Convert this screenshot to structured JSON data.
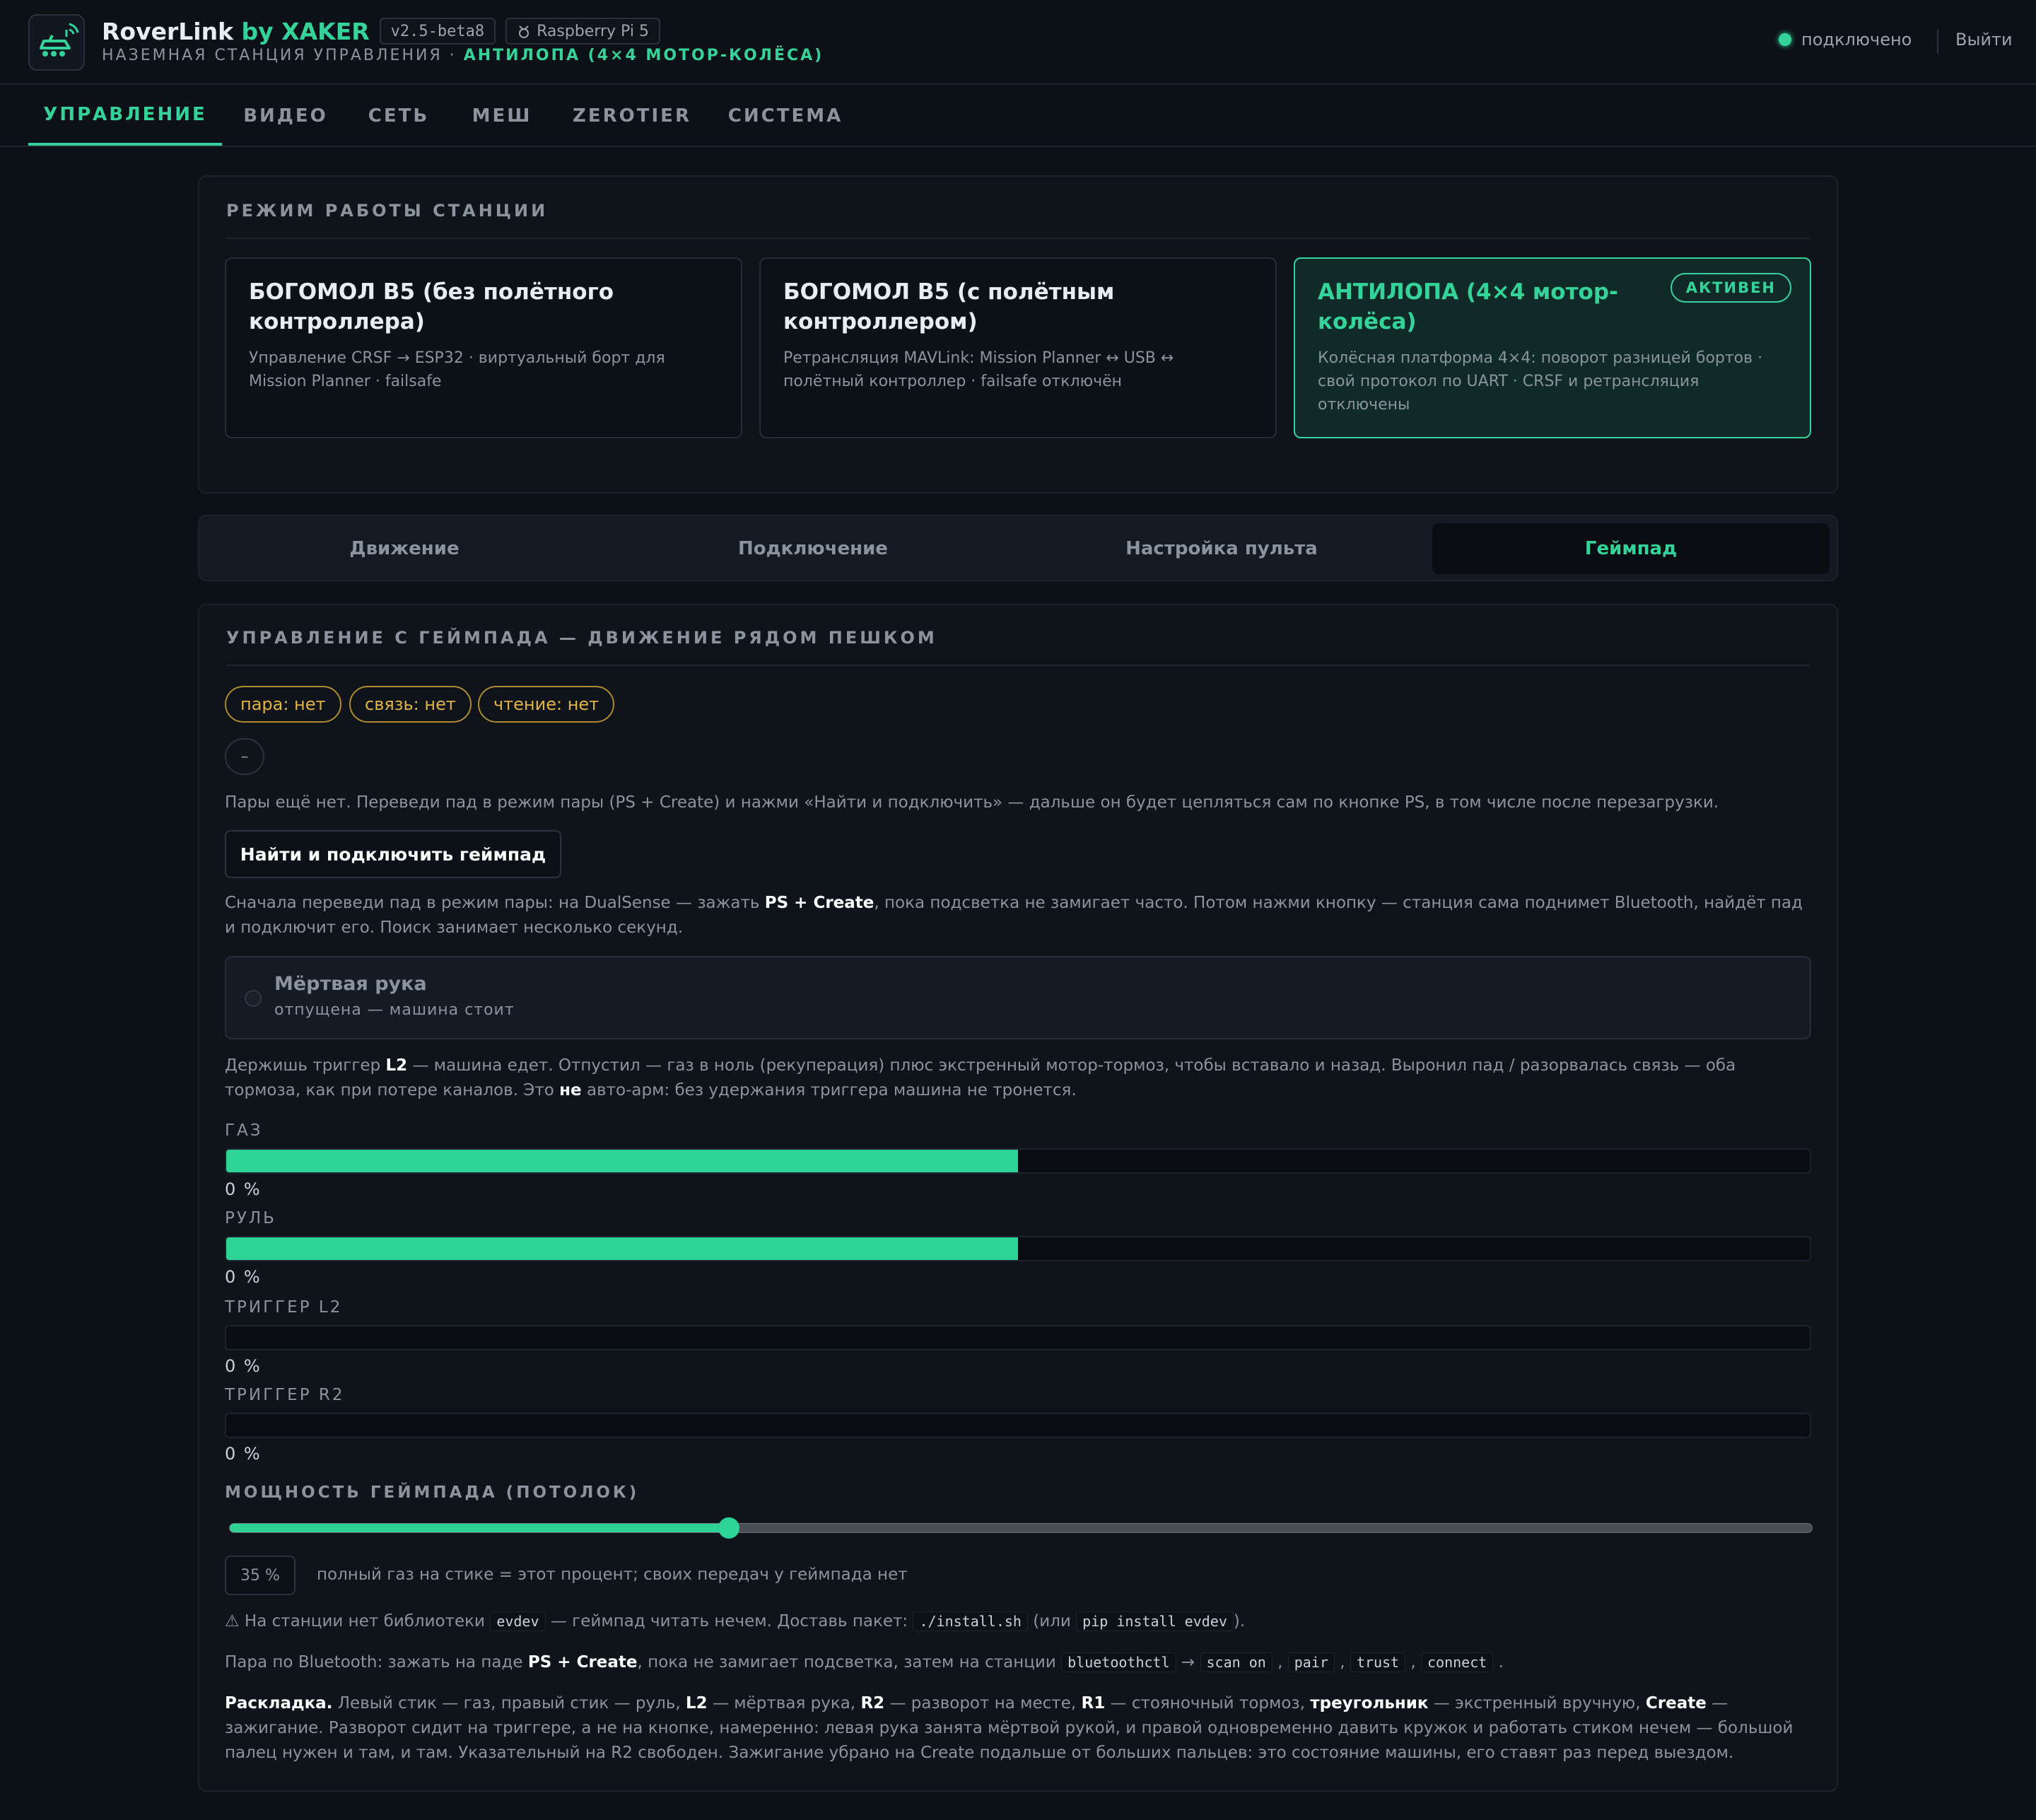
{
  "header": {
    "app_name": "RoverLink",
    "app_by": "by XAKER",
    "version": "v2.5-beta8",
    "platform": "Raspberry Pi 5",
    "subtitle_prefix": "НАЗЕМНАЯ СТАНЦИЯ УПРАВЛЕНИЯ ·",
    "subtitle_mode": "АНТИЛОПА (4×4 МОТОР-КОЛЁСА)",
    "status": "подключено",
    "logout": "Выйти"
  },
  "nav": [
    "УПРАВЛЕНИЕ",
    "ВИДЕО",
    "СЕТЬ",
    "МЕШ",
    "ZEROTIER",
    "СИСТЕМА"
  ],
  "modes": {
    "title": "РЕЖИМ РАБОТЫ СТАНЦИИ",
    "badge": "АКТИВЕН",
    "cards": [
      {
        "title": "БОГОМОЛ B5 (без полётного контроллера)",
        "desc": "Управление CRSF → ESP32 · виртуальный борт для Mission Planner · failsafe"
      },
      {
        "title": "БОГОМОЛ B5 (с полётным контроллером)",
        "desc": "Ретрансляция MAVLink: Mission Planner ↔ USB ↔ полётный контроллер · failsafe отключён"
      },
      {
        "title": "АНТИЛОПА (4×4 мотор-колёса)",
        "desc": "Колёсная платформа 4×4: поворот разницей бортов · свой протокол по UART · CRSF и ретрансляция отключены"
      }
    ]
  },
  "subtabs": [
    "Движение",
    "Подключение",
    "Настройка пульта",
    "Геймпад"
  ],
  "gamepad": {
    "title": "УПРАВЛЕНИЕ С ГЕЙМПАДА — ДВИЖЕНИЕ РЯДОМ ПЕШКОМ",
    "chips": [
      "пара: нет",
      "связь: нет",
      "чтение: нет"
    ],
    "dash": "–",
    "no_pair_text": "Пары ещё нет. Переведи пад в режим пары (PS + Create) и нажми «Найти и подключить» — дальше он будет цепляться сам по кнопке PS, в том числе после перезагрузки.",
    "connect_button": "Найти и подключить геймпад",
    "hint": {
      "a": "Сначала переведи пад в режим пары: на DualSense — зажать ",
      "b": "PS + Create",
      "c": ", пока подсветка не замигает часто. Потом нажми кнопку — станция сама поднимет Bluetooth, найдёт пад и подключит его. Поиск занимает несколько секунд."
    },
    "deadman_title": "Мёртвая рука",
    "deadman_sub": "отпущена — машина стоит",
    "deadman_text": {
      "a": "Держишь триггер ",
      "b": "L2",
      "c": " — машина едет. Отпустил — газ в ноль (рекуперация) плюс экстренный мотор-тормоз, чтобы вставало и назад. Выронил пад / разорвалась связь — оба тормоза, как при потере каналов. Это ",
      "d": "не",
      "e": " авто-арм: без удержания триггера машина не тронется."
    },
    "gauges": [
      {
        "label": "ГАЗ",
        "value": "0 %",
        "fill": 0.5
      },
      {
        "label": "РУЛЬ",
        "value": "0 %",
        "fill": 0.5
      },
      {
        "label": "ТРИГГЕР L2",
        "value": "0 %",
        "fill": 0
      },
      {
        "label": "ТРИГГЕР R2",
        "value": "0 %",
        "fill": 0
      }
    ],
    "power_title": "МОЩНОСТЬ ГЕЙМПАДА (ПОТОЛОК)",
    "power_value": 35,
    "power_display": "35 %",
    "power_note": "полный газ на стике = этот процент; своих передач у геймпада нет",
    "warn": {
      "a": "⚠ На станции нет библиотеки ",
      "code1": "evdev",
      "b": " — геймпад читать нечем. Доставь пакет: ",
      "code2": "./install.sh",
      "c": " (или ",
      "code3": "pip install evdev",
      "d": ")."
    },
    "bt": {
      "a": "Пара по Bluetooth: зажать на паде ",
      "b": "PS + Create",
      "c": ", пока не замигает подсветка, затем на станции ",
      "code1": "bluetoothctl",
      "arrow": " → ",
      "code2": "scan on",
      "code3": "pair",
      "code4": "trust",
      "code5": "connect",
      "sep": " , ",
      "end": " ."
    },
    "layout": {
      "title": "Раскладка.",
      "t1": " Левый стик — газ, правый стик — руль, ",
      "l2": "L2",
      "t2": " — мёртвая рука, ",
      "r2": "R2",
      "t3": " — разворот на месте, ",
      "r1": "R1",
      "t4": " — стояночный тормоз, ",
      "tri": "треугольник",
      "t5": " — экстренный вручную, ",
      "create": "Create",
      "t6": " — зажигание. Разворот сидит на триггере, а не на кнопке, намеренно: левая рука занята мёртвой рукой, и правой одновременно давить кружок и работать стиком нечем — большой палец нужен и там, и там. Указательный на R2 свободен. Зажигание убрано на Create подальше от больших пальцев: это состояние машины, его ставят раз перед выездом."
    }
  },
  "colors": {
    "accent": "#34d399",
    "warning": "#e3b341",
    "background": "#0c1117"
  }
}
